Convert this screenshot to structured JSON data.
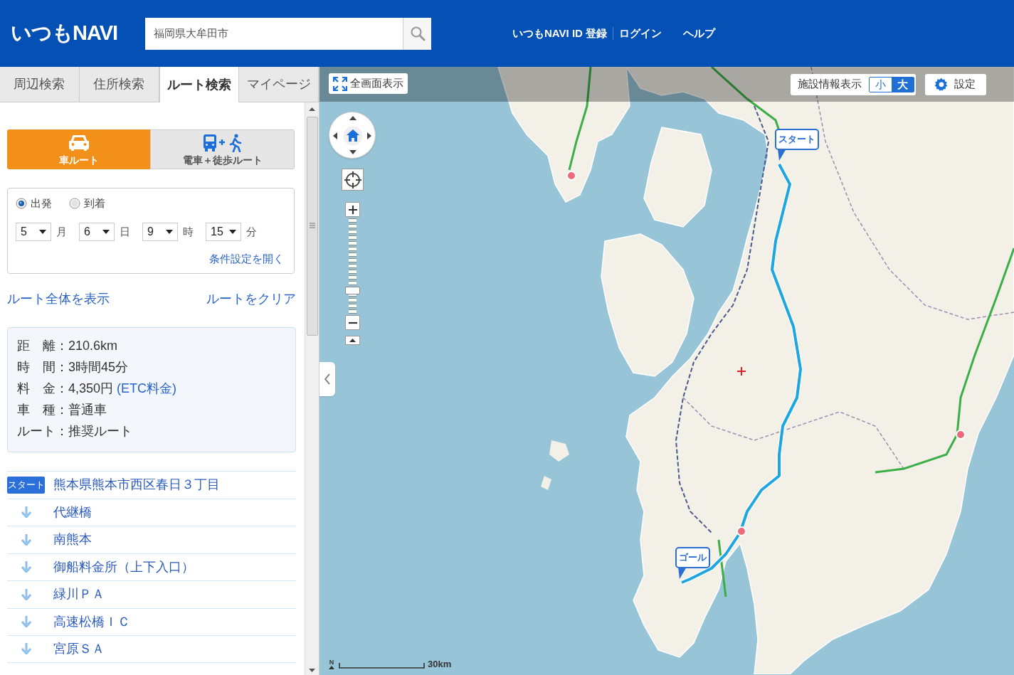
{
  "header": {
    "logo": "いつもNAVI",
    "search": {
      "value": "福岡県大牟田市"
    },
    "links": [
      {
        "label": "いつもNAVI ID 登録"
      },
      {
        "label": "ログイン"
      },
      {
        "label": "ヘルプ"
      }
    ]
  },
  "tabs": [
    {
      "label": "周辺検索",
      "selected": false
    },
    {
      "label": "住所検索",
      "selected": false
    },
    {
      "label": "ルート検索",
      "selected": true
    },
    {
      "label": "マイページ",
      "selected": false
    }
  ],
  "modes": [
    {
      "kind": "car",
      "label": "車ルート",
      "selected": true
    },
    {
      "kind": "train_walk",
      "label": "電車＋徒歩ルート",
      "selected": false
    }
  ],
  "conditions": {
    "options": [
      {
        "label": "出発",
        "selected": true
      },
      {
        "label": "到着",
        "selected": false
      }
    ],
    "selects": [
      {
        "value": "5",
        "unit": "月"
      },
      {
        "value": "6",
        "unit": "日"
      },
      {
        "value": "9",
        "unit": "時"
      },
      {
        "value": "15",
        "unit": "分"
      }
    ],
    "link": "条件設定を開く"
  },
  "route_actions": [
    {
      "label": "ルート全体を表示"
    },
    {
      "label": "ルートをクリア"
    }
  ],
  "summary": [
    {
      "label": "距　離：",
      "value": "210.6km"
    },
    {
      "label": "時　間：",
      "value": "3時間45分"
    },
    {
      "label": "料　金：",
      "value": "4,350円",
      "note": "(ETC料金)"
    },
    {
      "label": "車　種：",
      "value": "普通車"
    },
    {
      "label": "ルート：",
      "value": "推奨ルート"
    }
  ],
  "route": [
    {
      "kind": "start",
      "badge": "スタート",
      "name": "熊本県熊本市西区春日３丁目"
    },
    {
      "kind": "waypoint",
      "name": "代継橋"
    },
    {
      "kind": "waypoint",
      "name": "南熊本"
    },
    {
      "kind": "waypoint",
      "name": "御船料金所（上下入口）"
    },
    {
      "kind": "waypoint",
      "name": "緑川ＰＡ"
    },
    {
      "kind": "waypoint",
      "name": "高速松橋ＩＣ"
    },
    {
      "kind": "waypoint",
      "name": "宮原ＳＡ"
    }
  ],
  "map": {
    "toolbar": {
      "fullscreen": "全画面表示",
      "facility": {
        "label": "施設情報表示",
        "sizes": [
          {
            "label": "小",
            "selected": false
          },
          {
            "label": "大",
            "selected": true
          }
        ]
      },
      "settings": "設定"
    },
    "zoom": {
      "level": 0.23
    },
    "markers": [
      {
        "kind": "start",
        "label": "スタート"
      },
      {
        "kind": "goal",
        "label": "ゴール"
      }
    ],
    "scale": {
      "north": "N",
      "label": "30km"
    }
  }
}
